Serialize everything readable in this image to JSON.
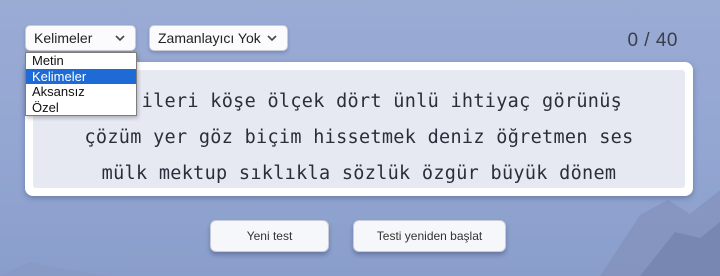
{
  "mode_select": {
    "value": "Kelimeler",
    "options": [
      "Metin",
      "Kelimeler",
      "Aksansız",
      "Özel"
    ],
    "selected_index": 1
  },
  "timer_select": {
    "value": "Zamanlayıcı Yok"
  },
  "counter": "0 / 40",
  "words": {
    "line1": "yük ileri köşe ölçek dört ünlü ihtiyaç görünüş",
    "line2": "çözüm yer göz biçim hissetmek deniz öğretmen ses",
    "line3": "mülk mektup sıklıkla sözlük özgür büyük dönem"
  },
  "buttons": {
    "new_test": "Yeni test",
    "restart": "Testi yeniden başlat"
  },
  "colors": {
    "background": "#93a6d2",
    "selected_option": "#1f6bd6",
    "card": "#ffffff",
    "card_inner": "#e6e9f2"
  },
  "icons": {
    "select_arrow": "chevron-down-icon"
  }
}
